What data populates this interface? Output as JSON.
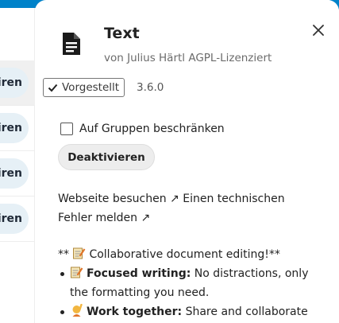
{
  "left_panel": {
    "items": [
      {
        "label": "iren"
      },
      {
        "label": "iren"
      },
      {
        "label": "iren"
      },
      {
        "label": "iren"
      }
    ]
  },
  "app": {
    "title": "Text",
    "author": "von Julius Härtl AGPL-Lizenziert",
    "featured_label": "Vorgestellt",
    "version": "3.6.0",
    "icon": "document-icon"
  },
  "actions": {
    "restrict_groups_label": "Auf Gruppen beschränken",
    "restrict_groups_checked": false,
    "deactivate_label": "Deaktivieren",
    "visit_website_label": "Webseite besuchen ↗",
    "report_bug_label": "Einen technischen Fehler melden ↗"
  },
  "description": {
    "heading_prefix": "** ",
    "heading_text": "Collaborative document editing!**",
    "bullets": [
      {
        "bold": "Focused writing:",
        "text": " No distractions, only the formatting you need."
      },
      {
        "bold": "Work together:",
        "text": " Share and collaborate"
      }
    ]
  },
  "colors": {
    "accent": "#0082c9",
    "pill_bg": "#e6f0f6"
  }
}
